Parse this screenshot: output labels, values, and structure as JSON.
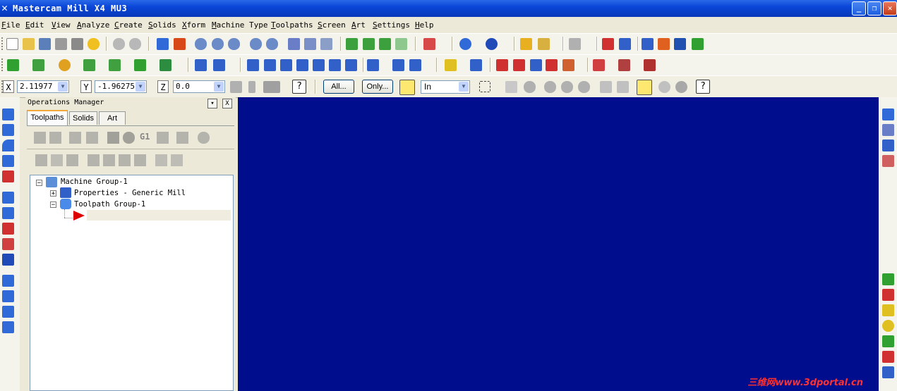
{
  "window": {
    "title": "Mastercam Mill X4 MU3",
    "minimize_glyph": "_",
    "maximize_glyph": "❐",
    "close_glyph": "✕"
  },
  "menu": [
    "File",
    "Edit",
    "View",
    "Analyze",
    "Create",
    "Solids",
    "Xform",
    "Machine Type",
    "Toolpaths",
    "Screen",
    "Art",
    "Settings",
    "Help"
  ],
  "coordinates": {
    "x_label": "X",
    "x_value": "2.11977",
    "y_label": "Y",
    "y_value": "-1.96275",
    "z_label": "Z",
    "z_value": "0.0"
  },
  "selection": {
    "all_label": "All...",
    "only_label": "Only...",
    "unit_value": "In"
  },
  "operations_manager": {
    "title": "Operations Manager",
    "pin_glyph": "▾",
    "close_glyph": "X",
    "tabs": [
      "Toolpaths",
      "Solids",
      "Art"
    ],
    "toolbar_g1_label": "G1",
    "tree": {
      "machine_group": "Machine Group-1",
      "properties": "Properties - Generic Mill",
      "toolpath_group": "Toolpath Group-1"
    }
  },
  "viewport": {
    "background_color": "#000d8d",
    "watermark": "三维网www.3dportal.cn"
  },
  "colors": {
    "titlebar": "#0a46d8",
    "insert_arrow": "#dd0000"
  }
}
